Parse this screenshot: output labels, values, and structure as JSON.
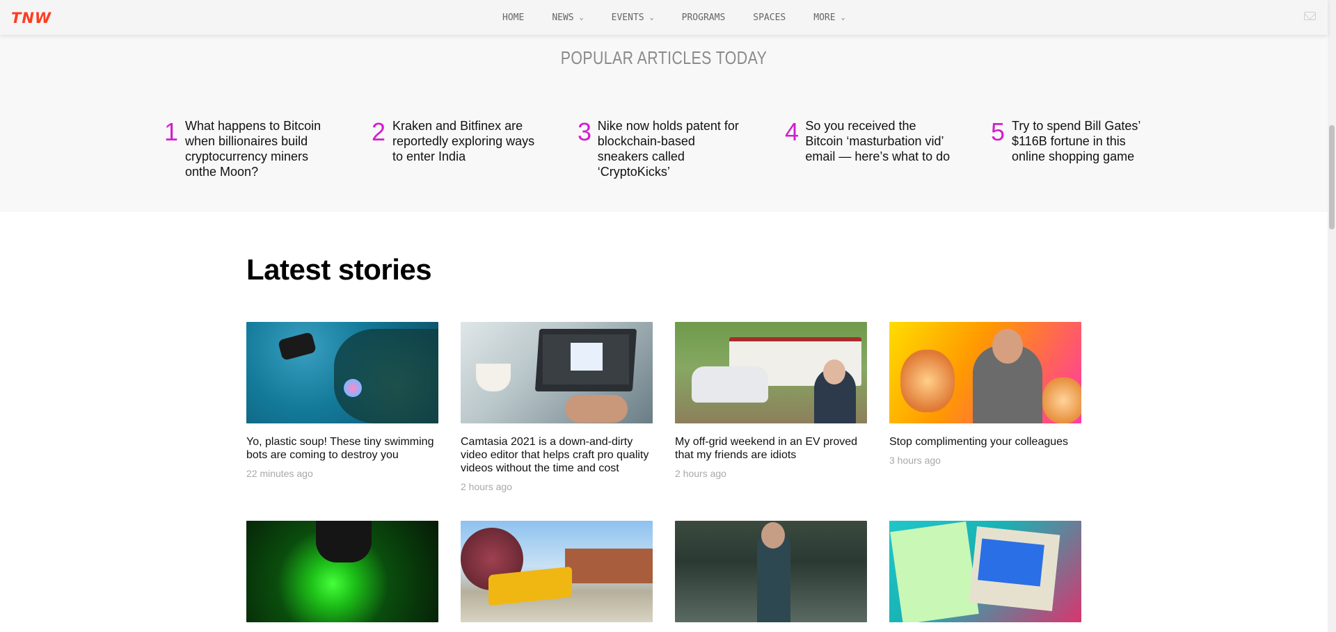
{
  "header": {
    "logo": "TNW",
    "nav": [
      {
        "label": "HOME",
        "has_dropdown": false
      },
      {
        "label": "NEWS",
        "has_dropdown": true
      },
      {
        "label": "EVENTS",
        "has_dropdown": true
      },
      {
        "label": "PROGRAMS",
        "has_dropdown": false
      },
      {
        "label": "SPACES",
        "has_dropdown": false
      },
      {
        "label": "MORE",
        "has_dropdown": true
      }
    ],
    "mail_icon": "mail-icon"
  },
  "popular": {
    "title": "POPULAR ARTICLES TODAY",
    "items": [
      {
        "num": "1",
        "title": "What happens to Bitcoin when billionaires build cryptocurrency miners onthe Moon?"
      },
      {
        "num": "2",
        "title": "Kraken and Bitfinex are reportedly exploring ways to enter India"
      },
      {
        "num": "3",
        "title": "Nike now holds patent for blockchain-based sneakers called ‘CryptoKicks’"
      },
      {
        "num": "4",
        "title": "So you received the Bitcoin ‘masturbation vid’ email — here’s what to do"
      },
      {
        "num": "5",
        "title": "Try to spend Bill Gates’ $116B fortune in this online shopping game"
      }
    ],
    "accent_color": "#d21fcf"
  },
  "latest": {
    "title": "Latest stories",
    "cards": [
      {
        "title": "Yo, plastic soup! These tiny swimming bots are coming to destroy you",
        "time": "22 minutes ago"
      },
      {
        "title": "Camtasia 2021 is a down-and-dirty video editor that helps craft pro quality videos without the time and cost",
        "time": "2 hours ago"
      },
      {
        "title": "My off-grid weekend in an EV proved that my friends are idiots",
        "time": "2 hours ago"
      },
      {
        "title": "Stop complimenting your colleagues",
        "time": "3 hours ago"
      },
      {
        "title": "",
        "time": ""
      },
      {
        "title": "",
        "time": ""
      },
      {
        "title": "",
        "time": ""
      },
      {
        "title": "",
        "time": ""
      }
    ]
  },
  "colors": {
    "brand": "#ff3c1f",
    "popular_bg": "#f8f8f8"
  }
}
